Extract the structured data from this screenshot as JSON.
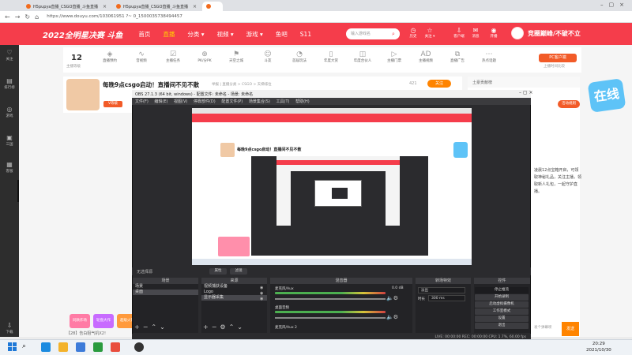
{
  "browser": {
    "tabs": [
      {
        "label": "H5pupya直播_CSGO直播_斗鱼直播",
        "active": false
      },
      {
        "label": "H5pupya直播_CSGO直播_斗鱼直播",
        "active": false
      },
      {
        "label": "H5pupya直播_CSGO直播_斗鱼直播",
        "active": true
      }
    ],
    "url": "https://www.douyu.com/103061951 ?~ 0_1500035738494457"
  },
  "douyu": {
    "logo": "2022全明星决赛 斗鱼",
    "nav": [
      "首页",
      "直播",
      "分类 ▾",
      "视频 ▾",
      "游戏 ▾",
      "鱼吧",
      "S11"
    ],
    "search_placeholder": "输入游戏名",
    "header_icons": [
      {
        "icon": "history-icon",
        "label": "历史"
      },
      {
        "icon": "star-icon",
        "label": "关注 ▾"
      },
      {
        "icon": "upload-icon",
        "label": "客户端"
      },
      {
        "icon": "chat-icon",
        "label": "消息"
      },
      {
        "icon": "broadcast-icon",
        "label": "开播"
      }
    ],
    "brand_right": "竞圈巅峰/不破不立"
  },
  "sidebar": {
    "items": [
      {
        "icon": "follow-icon",
        "label": "关注"
      },
      {
        "icon": "rank-icon",
        "label": "排行榜"
      },
      {
        "icon": "gamepad-icon",
        "label": "游戏"
      },
      {
        "icon": "bag-icon",
        "label": "三国"
      },
      {
        "icon": "box-icon",
        "label": "客服"
      },
      {
        "icon": "gift-icon",
        "label": "下载"
      }
    ]
  },
  "categories": {
    "level_number": "12",
    "level_label": "主播等级",
    "items": [
      "直播预约",
      "音视频",
      "主播任务",
      "PK/分PK",
      "天空之城",
      "斗友",
      "首届玩法",
      "年度大赏",
      "年度合伙人",
      "主播门票",
      "主播视频",
      "直播广告",
      "热点话题",
      "全部"
    ],
    "pc_client": "PC客户端",
    "pc_sub": "上播时间比较"
  },
  "room": {
    "title": "每晚9点csgo启动！直播间不见不散",
    "meta": "举报 | 直播分类 > CSGO > 天梯排位",
    "badge": "V等级",
    "follow": "关注",
    "view_count": "421"
  },
  "right_panel": {
    "top_label": "土豪贡献榜",
    "badge": "活动规则",
    "text": "凌晨12点宝箱开启，可领取神秘礼品，关注主播，领取新人礼包，一起守护直播。",
    "input_placeholder": "发个弹幕呗",
    "send": "发送",
    "widget_text": "在线"
  },
  "gifts": [
    {
      "label": "同款炸场",
      "color": "#ff7ba5"
    },
    {
      "label": "轮盘大作",
      "color": "#c86bff"
    },
    {
      "label": "超级火箭",
      "color": "#ff9a3c"
    }
  ],
  "ticker": "【28】告白阻气机X2!",
  "obs": {
    "title": "OBS 27.1.3 (64 bit, windows) - 配置文件: 未命名 - 场景: 未命名",
    "menu": [
      "文件(F)",
      "编辑(E)",
      "视图(V)",
      "停靠部件(D)",
      "配置文件(P)",
      "场景集合(S)",
      "工具(T)",
      "帮助(H)"
    ],
    "scene_bar": "无选择源",
    "filter_btn": "属性",
    "filter_btn2": "滤镜",
    "preview": {
      "title": "每晚9点csgo启动！直播间不见不散"
    },
    "docks": {
      "scenes_title": "场景",
      "sources_title": "来源",
      "mixer_title": "混音器",
      "transitions_title": "转场特效",
      "controls_title": "控件"
    },
    "scenes": [
      "场景",
      "桌面"
    ],
    "sources": [
      "视频捕获设备",
      "Logo",
      "显示器采集"
    ],
    "mixer": [
      {
        "name": "麦克风/Aux",
        "db": "0.0 dB",
        "level": 0.55
      },
      {
        "name": "桌面音频",
        "db": "0.0 dB",
        "level": 0.35
      },
      {
        "name": "麦克风/Aux 2",
        "db": "0.0 dB",
        "level": 0.4
      }
    ],
    "transitions": {
      "type": "淡出",
      "duration_label": "时长",
      "duration": "300 ms"
    },
    "controls": [
      "停止推流",
      "开始录制",
      "启动虚拟摄像机",
      "工作室模式",
      "设置",
      "退出"
    ],
    "status": "LIVE: 00:00:00   REC: 00:00:00   CPU: 1.7%, 60.00 fps"
  },
  "taskbar": {
    "time": "20:29",
    "date": "2021/10/30"
  }
}
